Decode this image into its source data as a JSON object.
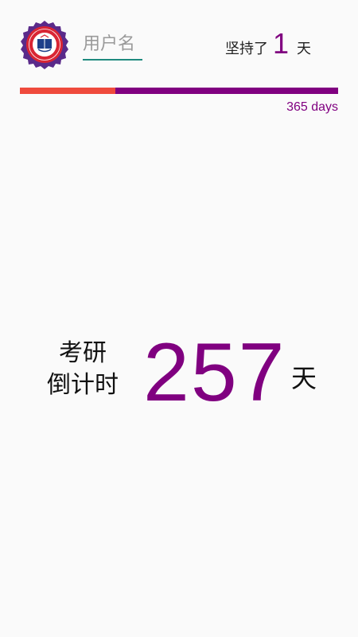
{
  "header": {
    "username_placeholder": "用户名",
    "persist_prefix": "坚持了",
    "persist_count": "1",
    "persist_suffix": "天"
  },
  "progress": {
    "label": "365 days",
    "fraction": 0.3,
    "fill_color": "#ef4a3c",
    "track_color": "#800080"
  },
  "countdown": {
    "label_line1": "考研",
    "label_line2": "倒计时",
    "days": "257",
    "unit": "天",
    "number_color": "#800080"
  },
  "icons": {
    "logo": "school-emblem-logo"
  }
}
